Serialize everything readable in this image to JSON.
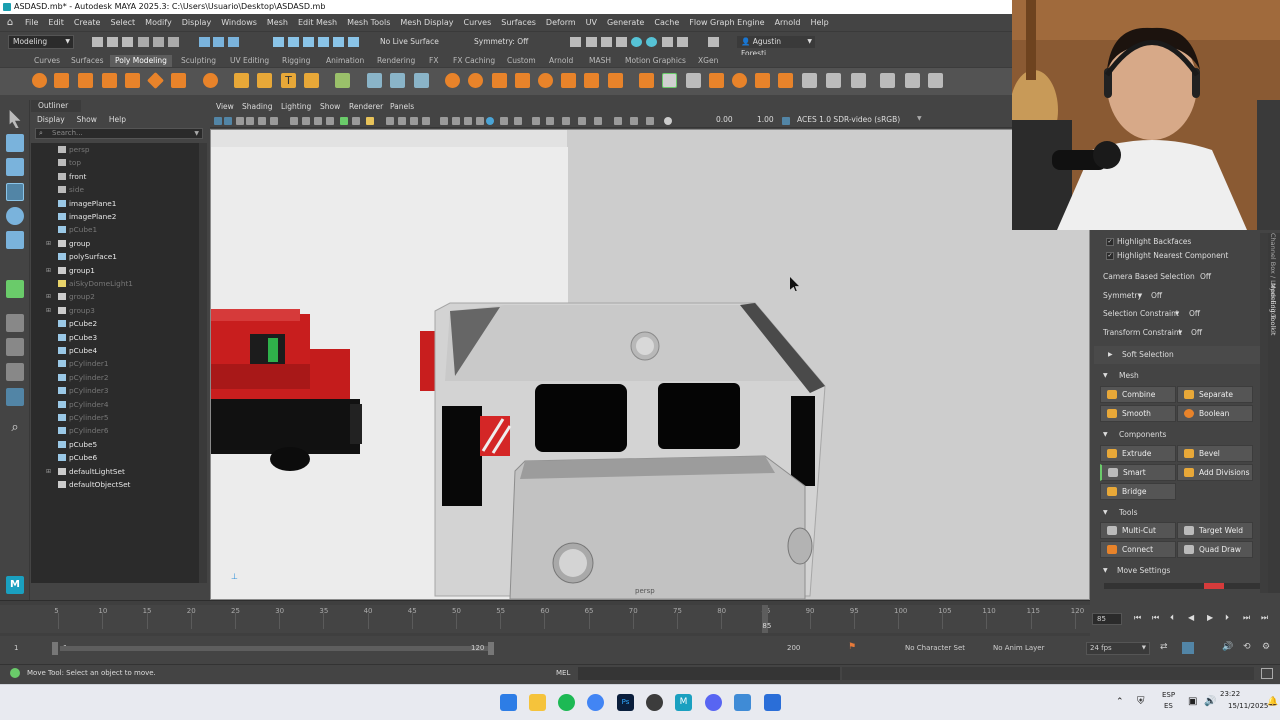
{
  "window": {
    "title": "ASDASD.mb* - Autodesk MAYA 2025.3: C:\\Users\\Usuario\\Desktop\\ASDASD.mb"
  },
  "menubar": [
    "File",
    "Edit",
    "Create",
    "Select",
    "Modify",
    "Display",
    "Windows",
    "Mesh",
    "Edit Mesh",
    "Mesh Tools",
    "Mesh Display",
    "Curves",
    "Surfaces",
    "Deform",
    "UV",
    "Generate",
    "Cache",
    "Flow Graph Engine",
    "Arnold",
    "Help"
  ],
  "statusline": {
    "workspace": "Modeling",
    "live_surface": "No Live Surface",
    "symmetry": "Symmetry: Off",
    "user": "Agustin Foresti..."
  },
  "shelf": {
    "tabs": [
      "Curves",
      "Surfaces",
      "Poly Modeling",
      "Sculpting",
      "UV Editing",
      "Rigging",
      "Animation",
      "Rendering",
      "FX",
      "FX Caching",
      "Custom",
      "Arnold",
      "MASH",
      "Motion Graphics",
      "XGen"
    ],
    "active_tab": "Poly Modeling"
  },
  "outliner": {
    "title": "Outliner",
    "menu": [
      "Display",
      "Show",
      "Help"
    ],
    "search_placeholder": "Search...",
    "items": [
      {
        "label": "persp",
        "dim": true,
        "icon": "camera-icon"
      },
      {
        "label": "top",
        "dim": true,
        "icon": "camera-icon"
      },
      {
        "label": "front",
        "dim": false,
        "icon": "camera-icon"
      },
      {
        "label": "side",
        "dim": true,
        "icon": "camera-icon"
      },
      {
        "label": "imagePlane1",
        "dim": false,
        "icon": "image-plane-icon"
      },
      {
        "label": "imagePlane2",
        "dim": false,
        "icon": "image-plane-icon"
      },
      {
        "label": "pCube1",
        "dim": true,
        "icon": "mesh-icon"
      },
      {
        "label": "group",
        "dim": false,
        "icon": "group-icon",
        "expand": true
      },
      {
        "label": "polySurface1",
        "dim": false,
        "icon": "mesh-icon"
      },
      {
        "label": "group1",
        "dim": false,
        "icon": "group-icon",
        "expand": true
      },
      {
        "label": "aiSkyDomeLight1",
        "dim": true,
        "icon": "light-icon"
      },
      {
        "label": "group2",
        "dim": true,
        "icon": "group-icon",
        "expand": true
      },
      {
        "label": "group3",
        "dim": true,
        "icon": "group-icon",
        "expand": true
      },
      {
        "label": "pCube2",
        "dim": false,
        "icon": "mesh-icon"
      },
      {
        "label": "pCube3",
        "dim": false,
        "icon": "mesh-icon"
      },
      {
        "label": "pCube4",
        "dim": false,
        "icon": "mesh-icon"
      },
      {
        "label": "pCylinder1",
        "dim": true,
        "icon": "mesh-icon"
      },
      {
        "label": "pCylinder2",
        "dim": true,
        "icon": "mesh-icon"
      },
      {
        "label": "pCylinder3",
        "dim": true,
        "icon": "mesh-icon"
      },
      {
        "label": "pCylinder4",
        "dim": true,
        "icon": "mesh-icon"
      },
      {
        "label": "pCylinder5",
        "dim": true,
        "icon": "mesh-icon"
      },
      {
        "label": "pCylinder6",
        "dim": true,
        "icon": "mesh-icon"
      },
      {
        "label": "pCube5",
        "dim": false,
        "icon": "mesh-icon"
      },
      {
        "label": "pCube6",
        "dim": false,
        "icon": "mesh-icon"
      },
      {
        "label": "defaultLightSet",
        "dim": false,
        "icon": "set-icon",
        "expand": true
      },
      {
        "label": "defaultObjectSet",
        "dim": false,
        "icon": "set-icon"
      }
    ]
  },
  "viewport": {
    "menu": [
      "View",
      "Shading",
      "Lighting",
      "Show",
      "Renderer",
      "Panels"
    ],
    "exposure": "0.00",
    "gamma": "1.00",
    "color_space": "ACES 1.0 SDR-video (sRGB)",
    "camera_label": "persp"
  },
  "modeling_toolkit": {
    "checks": [
      "Highlight Backfaces",
      "Highlight Nearest Component"
    ],
    "options": [
      {
        "label": "Camera Based Selection",
        "value": "Off"
      },
      {
        "label": "Symmetry",
        "value": "Off"
      },
      {
        "label": "Selection Constraint",
        "value": "Off"
      },
      {
        "label": "Transform Constraint",
        "value": "Off"
      }
    ],
    "soft_selection": "Soft Selection",
    "mesh_header": "Mesh",
    "mesh_buttons": [
      "Combine",
      "Separate",
      "Smooth",
      "Boolean"
    ],
    "components_header": "Components",
    "component_buttons": [
      "Extrude",
      "Bevel",
      "Smart Extrude",
      "Add Divisions",
      "Bridge"
    ],
    "tools_header": "Tools",
    "tool_buttons": [
      "Multi-Cut",
      "Target Weld",
      "Connect",
      "Quad Draw"
    ],
    "move_settings": "Move Settings",
    "side_tabs": [
      "Channel Box / Layer Editor",
      "Modeling Toolkit"
    ]
  },
  "timeline": {
    "ticks": [
      "5",
      "10",
      "15",
      "20",
      "25",
      "30",
      "35",
      "40",
      "45",
      "50",
      "55",
      "60",
      "65",
      "70",
      "75",
      "80",
      "85",
      "90",
      "95",
      "100",
      "105",
      "110",
      "115",
      "120"
    ],
    "current_frame": "85",
    "current_frame_field": "85"
  },
  "range": {
    "start": "1",
    "inner_start": "1",
    "inner_end": "120",
    "end": "200",
    "character_set": "No Character Set",
    "anim_layer": "No Anim Layer",
    "fps": "24 fps"
  },
  "commandline": {
    "help_text": "Move Tool: Select an object to move.",
    "lang": "MEL"
  },
  "taskbar": {
    "lang_top": "ESP",
    "lang_bottom": "ES",
    "time": "23:22",
    "date": "15/11/2025"
  },
  "colors": {
    "maya_bg": "#444444",
    "accent": "#5285a6",
    "locomotive_red": "#c81e1e"
  }
}
